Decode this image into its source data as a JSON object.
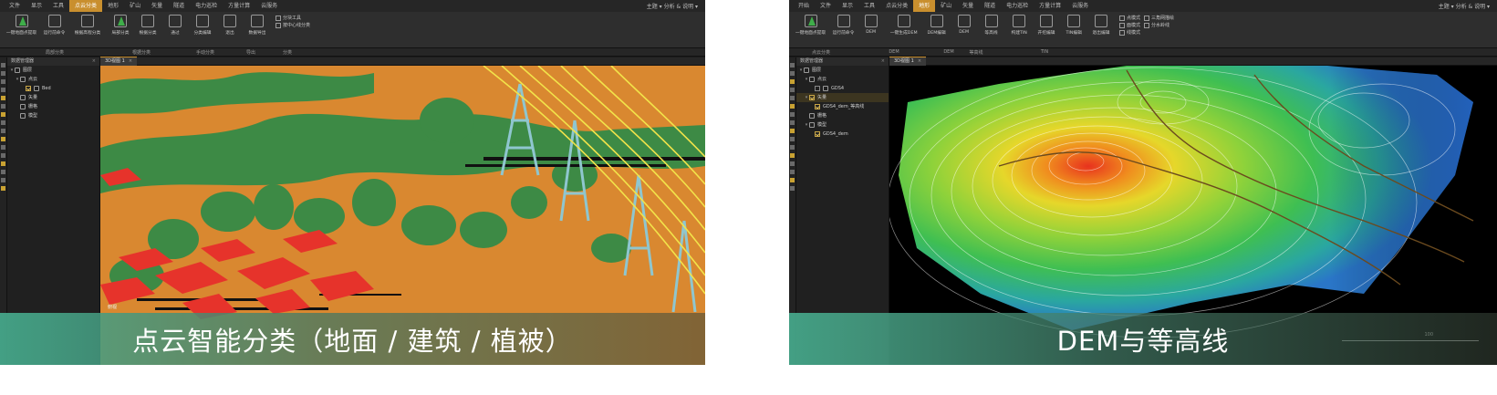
{
  "colors": {
    "accent_tab": "#c98f2e",
    "ground_class": "#d98830",
    "vegetation_class": "#3d8a45",
    "building_class": "#e6332b",
    "powerline_class": "#f2e34a",
    "tower_class": "#8fc6cf"
  },
  "left": {
    "menu": [
      "文件",
      "显示",
      "工具",
      "点云分类",
      "地形",
      "矿山",
      "矢量",
      "隧道",
      "电力巡检",
      "方量计算",
      "云服务"
    ],
    "menu_right": "主题 ▾  分析 & 说明 ▾",
    "ribbon": {
      "tools": [
        "一键地面点提取",
        "运行前命令",
        "根据高程分类",
        "局部分类",
        "根据分类",
        "通过",
        "分类编辑",
        "退出",
        "数据导出"
      ],
      "mini": [
        "分块工具",
        "按中心线分类"
      ]
    },
    "groups": [
      "局部分类",
      "根据分类",
      "手动分类",
      "导出",
      "分类"
    ],
    "sidebar": {
      "title": "数据管理器",
      "items": [
        "图层",
        "点云",
        "Bed",
        "矢量",
        "栅格",
        "模型"
      ]
    },
    "tab": "3D视图 1",
    "corner_label": "俯视",
    "caption": "点云智能分类（地面 / 建筑 / 植被）"
  },
  "right": {
    "menu": [
      "开始",
      "文件",
      "显示",
      "工具",
      "点云分类",
      "地形",
      "矿山",
      "矢量",
      "隧道",
      "电力巡检",
      "方量计算",
      "云服务"
    ],
    "menu_right": "主题 ▾  分析 & 说明 ▾",
    "ribbon": {
      "tools": [
        "一键地面点提取",
        "运行前命令",
        "DEM",
        "一键生成DEM",
        "DEM编辑",
        "DEM",
        "等高线",
        "构建TIN",
        "开挖编辑",
        "TIN编辑",
        "退出编辑"
      ],
      "mini": [
        "点模式",
        "面模式",
        "线模式",
        "三角网描绘",
        "分水岭线"
      ]
    },
    "groups": [
      "点云分类",
      "DEM",
      "DEM",
      "等高线",
      "TIN"
    ],
    "sidebar": {
      "title": "数据管理器",
      "items": [
        "图层",
        "点云",
        "GDS4",
        "矢量",
        "GDS4_dem_等高线",
        "栅格",
        "模型",
        "GDS4_dem"
      ]
    },
    "tab": "3D视图 1",
    "scale_label": "100",
    "caption": "DEM与等高线"
  }
}
